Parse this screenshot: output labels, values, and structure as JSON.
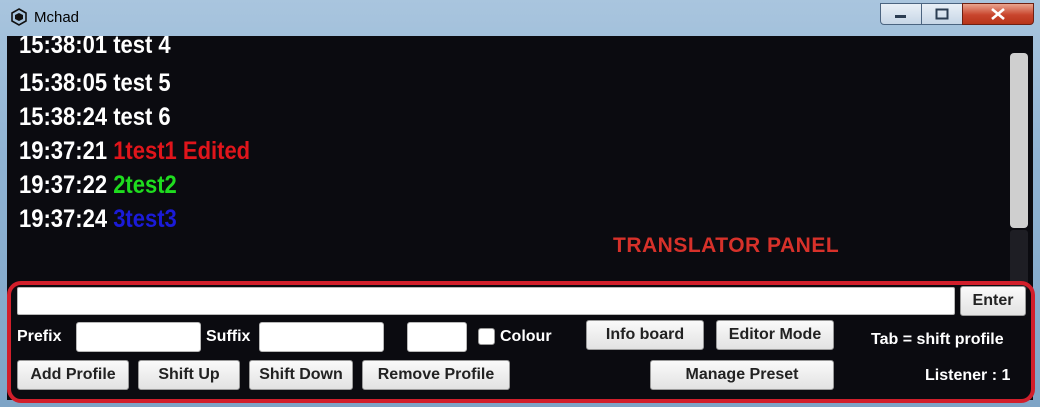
{
  "window": {
    "title": "Mchad"
  },
  "log": {
    "lines": [
      {
        "time": "15:38:01",
        "text": "test 4",
        "color": "#ffffff"
      },
      {
        "time": "15:38:05",
        "text": "test 5",
        "color": "#ffffff"
      },
      {
        "time": "15:38:24",
        "text": "test 6",
        "color": "#ffffff"
      },
      {
        "time": "19:37:21",
        "text": "1test1 Edited",
        "color": "#e0151b"
      },
      {
        "time": "19:37:22",
        "text": "2test2",
        "color": "#1fdc1f"
      },
      {
        "time": "19:37:24",
        "text": "3test3",
        "color": "#1b1bd8"
      }
    ]
  },
  "panel": {
    "label": "TRANSLATOR PANEL",
    "enter_label": "Enter",
    "prefix_label": "Prefix",
    "suffix_label": "Suffix",
    "colour_label": "Colour",
    "info_board_label": "Info board",
    "editor_mode_label": "Editor Mode",
    "tab_hint": "Tab = shift profile",
    "add_profile_label": "Add Profile",
    "shift_up_label": "Shift Up",
    "shift_down_label": "Shift Down",
    "remove_profile_label": "Remove Profile",
    "manage_preset_label": "Manage Preset",
    "listener_text": "Listener : 1"
  },
  "colors": {
    "highlight_outline": "#d21f2b",
    "panel_label": "#d7312a"
  }
}
